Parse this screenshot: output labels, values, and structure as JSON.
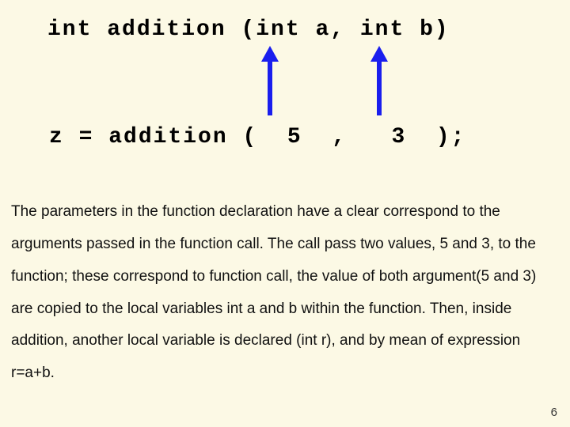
{
  "code": {
    "declaration": "int addition (int a, int b)",
    "call": "z = addition (  5  ,   3  );"
  },
  "body": "The parameters in the function declaration have a clear correspond to the arguments passed in the function call. The call pass two values, 5 and 3, to the function; these correspond to function call, the value of both argument(5 and 3) are copied to the local variables int a and b within the function. Then, inside addition, another local variable is declared (int r), and by mean of expression r=a+b.",
  "page_number": "6"
}
